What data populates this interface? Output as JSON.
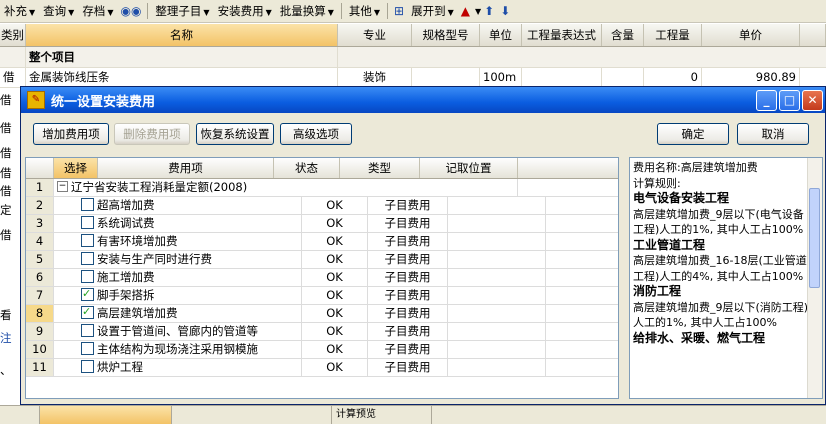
{
  "toolbar": {
    "items": [
      "补充",
      "查询",
      "存档",
      "整理子目",
      "安装费用",
      "批量换算",
      "其他",
      "展开到"
    ]
  },
  "grid": {
    "headers": [
      "类别",
      "名称",
      "专业",
      "规格型号",
      "单位",
      "工程量表达式",
      "含量",
      "工程量",
      "单价"
    ],
    "section_label": "整个项目",
    "row1": {
      "type": "借",
      "name": "金属装饰线压条",
      "major": "装饰",
      "unit": "100m",
      "qty": "0",
      "price": "980.89"
    },
    "left_fragments": [
      "借",
      "借",
      "借",
      "借",
      "借",
      "借",
      "定",
      "借",
      "看",
      "注",
      "、"
    ]
  },
  "dialog": {
    "title": "统一设置安装费用",
    "buttons": {
      "add": "增加费用项",
      "delete": "删除费用项",
      "restore": "恢复系统设置",
      "advanced": "高级选项",
      "ok": "确定",
      "cancel": "取消"
    },
    "table": {
      "headers": [
        "选择",
        "费用项",
        "状态",
        "类型",
        "记取位置"
      ],
      "group": {
        "num": "1",
        "name": "辽宁省安装工程消耗量定额(2008)"
      },
      "rows": [
        {
          "num": "2",
          "checked": false,
          "name": "超高增加费",
          "status": "OK",
          "type": "子目费用"
        },
        {
          "num": "3",
          "checked": false,
          "name": "系统调试费",
          "status": "OK",
          "type": "子目费用"
        },
        {
          "num": "4",
          "checked": false,
          "name": "有害环境增加费",
          "status": "OK",
          "type": "子目费用"
        },
        {
          "num": "5",
          "checked": false,
          "name": "安装与生产同时进行费",
          "status": "OK",
          "type": "子目费用"
        },
        {
          "num": "6",
          "checked": false,
          "name": "施工增加费",
          "status": "OK",
          "type": "子目费用"
        },
        {
          "num": "7",
          "checked": true,
          "name": "脚手架搭拆",
          "status": "OK",
          "type": "子目费用"
        },
        {
          "num": "8",
          "checked": true,
          "name": "高层建筑增加费",
          "status": "OK",
          "type": "子目费用"
        },
        {
          "num": "9",
          "checked": false,
          "name": "设置于管道间、管廊内的管道等",
          "status": "OK",
          "type": "子目费用"
        },
        {
          "num": "10",
          "checked": false,
          "name": "主体结构为现场浇注采用钢模施",
          "status": "OK",
          "type": "子目费用"
        },
        {
          "num": "11",
          "checked": false,
          "name": "烘炉工程",
          "status": "OK",
          "type": "子目费用"
        }
      ]
    },
    "info": {
      "lines": [
        {
          "bold": false,
          "text": "费用名称:高层建筑增加费"
        },
        {
          "bold": false,
          "text": "计算规则:"
        },
        {
          "bold": true,
          "text": "电气设备安装工程"
        },
        {
          "bold": false,
          "text": "高层建筑增加费_9层以下(电气设备工程)人工的1%, 其中人工占100%"
        },
        {
          "bold": true,
          "text": "工业管道工程"
        },
        {
          "bold": false,
          "text": "高层建筑增加费_16-18层(工业管道工程)人工的4%, 其中人工占100%"
        },
        {
          "bold": true,
          "text": "消防工程"
        },
        {
          "bold": false,
          "text": "高层建筑增加费_9层以下(消防工程)人工的1%, 其中人工占100%"
        },
        {
          "bold": true,
          "text": "给排水、采暖、燃气工程"
        }
      ]
    }
  },
  "statusbar": {
    "cells": [
      "",
      "",
      "计算预览",
      ""
    ]
  }
}
